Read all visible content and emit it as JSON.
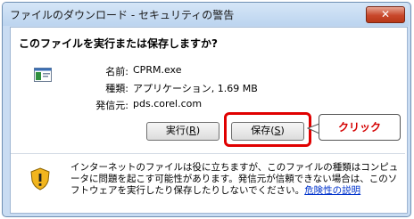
{
  "window": {
    "title": "ファイルのダウンロード - セキュリティの警告",
    "close_glyph": "✕"
  },
  "question": "このファイルを実行または保存しますか?",
  "file_info": {
    "name_label": "名前:",
    "name_value": "CPRM.exe",
    "type_label": "種類:",
    "type_value": "アプリケーション, 1.69 MB",
    "source_label": "発信元:",
    "source_value": "pds.corel.com"
  },
  "buttons": {
    "run_label": "実行(",
    "run_key": "R",
    "run_close": ")",
    "save_label": "保存(",
    "save_key": "S",
    "save_close": ")"
  },
  "callout": {
    "text": "クリック",
    "color": "#d40000"
  },
  "warning": {
    "text": "インターネットのファイルは役に立ちますが、このファイルの種類はコンピュータに問題を起こす可能性があります。発信元が信頼できない場合は、このソフトウェアを実行したり保存したりしないでください。",
    "link_text": "危険性の説明"
  },
  "icons": {
    "app": "application-icon",
    "shield": "warning-shield-icon"
  }
}
